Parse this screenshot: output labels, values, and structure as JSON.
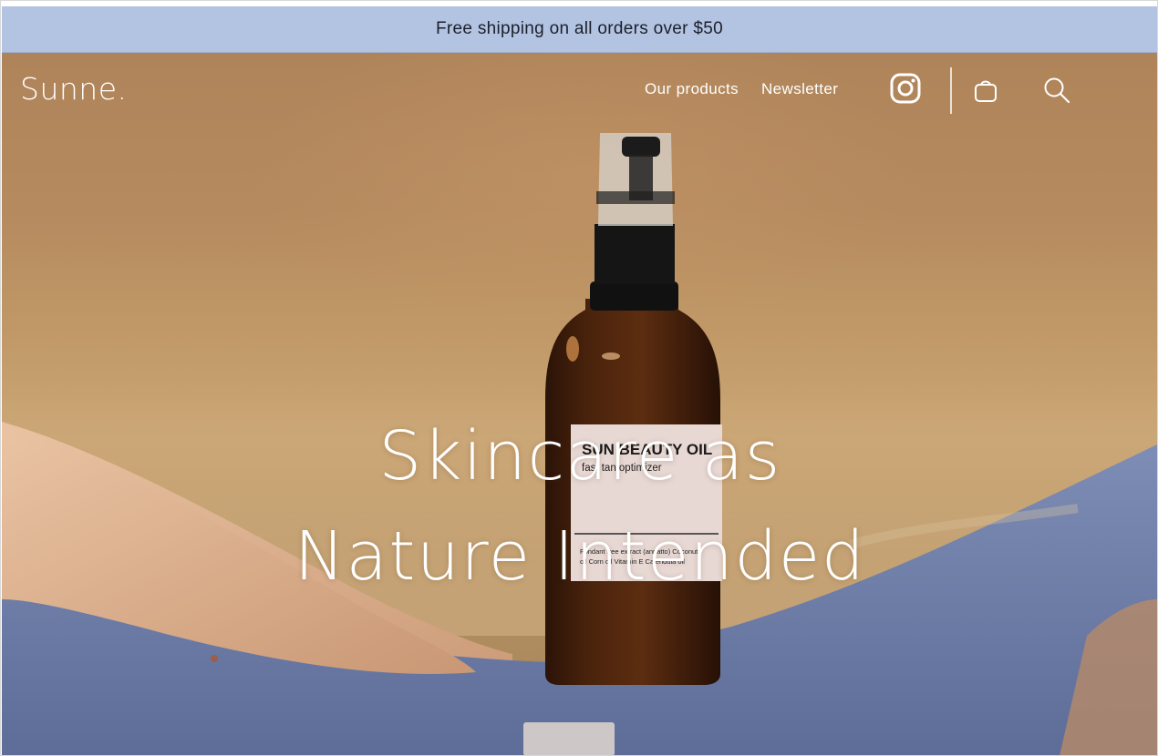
{
  "announcement": {
    "text": "Free shipping on all orders over $50"
  },
  "header": {
    "logo": "Sunne.",
    "nav": [
      {
        "label": "Our products"
      },
      {
        "label": "Newsletter"
      }
    ],
    "icons": [
      "instagram-icon",
      "shopping-bag-icon",
      "search-icon"
    ]
  },
  "hero": {
    "headline_line1": "Skincare as",
    "headline_line2": "Nature Intended",
    "product": {
      "name": "SUN BEAUTY OIL",
      "subtitle": "fast tan optimizer",
      "ingredients_line1": "Fondant tree extract (annatto) Coconut",
      "ingredients_line2": "oil Corn oil Vitamin E Calendula oil"
    }
  },
  "colors": {
    "announcement_bg": "#b3c3e2",
    "hero_warm": "#b48a5e",
    "swimsuit_blue": "#6f80ab",
    "text_on_hero": "#ffffff"
  }
}
